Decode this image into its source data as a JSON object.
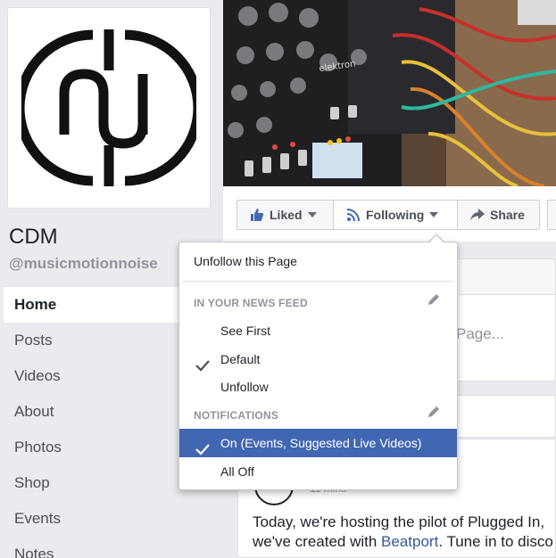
{
  "page": {
    "name": "CDM",
    "handle": "@musicmotionnoise"
  },
  "left_nav": {
    "items": [
      {
        "label": "Home",
        "active": true
      },
      {
        "label": "Posts",
        "active": false
      },
      {
        "label": "Videos",
        "active": false
      },
      {
        "label": "About",
        "active": false
      },
      {
        "label": "Photos",
        "active": false
      },
      {
        "label": "Shop",
        "active": false
      },
      {
        "label": "Events",
        "active": false
      },
      {
        "label": "Notes",
        "active": false
      }
    ]
  },
  "action_bar": {
    "liked_label": "Liked",
    "following_label": "Following",
    "share_label": "Share",
    "liked_icon": "thumbs-up-icon",
    "following_icon": "rss-feed-icon",
    "share_icon": "share-arrow-icon"
  },
  "dropdown": {
    "unfollow_page": "Unfollow this Page",
    "news_feed_header": "IN YOUR NEWS FEED",
    "news_feed_options": [
      {
        "label": "See First",
        "checked": false
      },
      {
        "label": "Default",
        "checked": true
      },
      {
        "label": "Unfollow",
        "checked": false
      }
    ],
    "notifications_header": "NOTIFICATIONS",
    "notification_options": [
      {
        "label": "On (Events, Suggested Live Videos)",
        "checked": true,
        "highlighted": true
      },
      {
        "label": "All Off",
        "checked": false
      }
    ]
  },
  "feed": {
    "partial_hint": "Page...",
    "post_meta": "11 mins",
    "post_line1": "Today, we're hosting the pilot of Plugged In,",
    "post_line2_prefix": "we've created with ",
    "post_line2_link": "Beatport",
    "post_line2_suffix": ". Tune in to disco"
  },
  "colors": {
    "accent": "#4267b2",
    "link": "#365899",
    "muted": "#90949c",
    "background": "#e9ebee"
  }
}
